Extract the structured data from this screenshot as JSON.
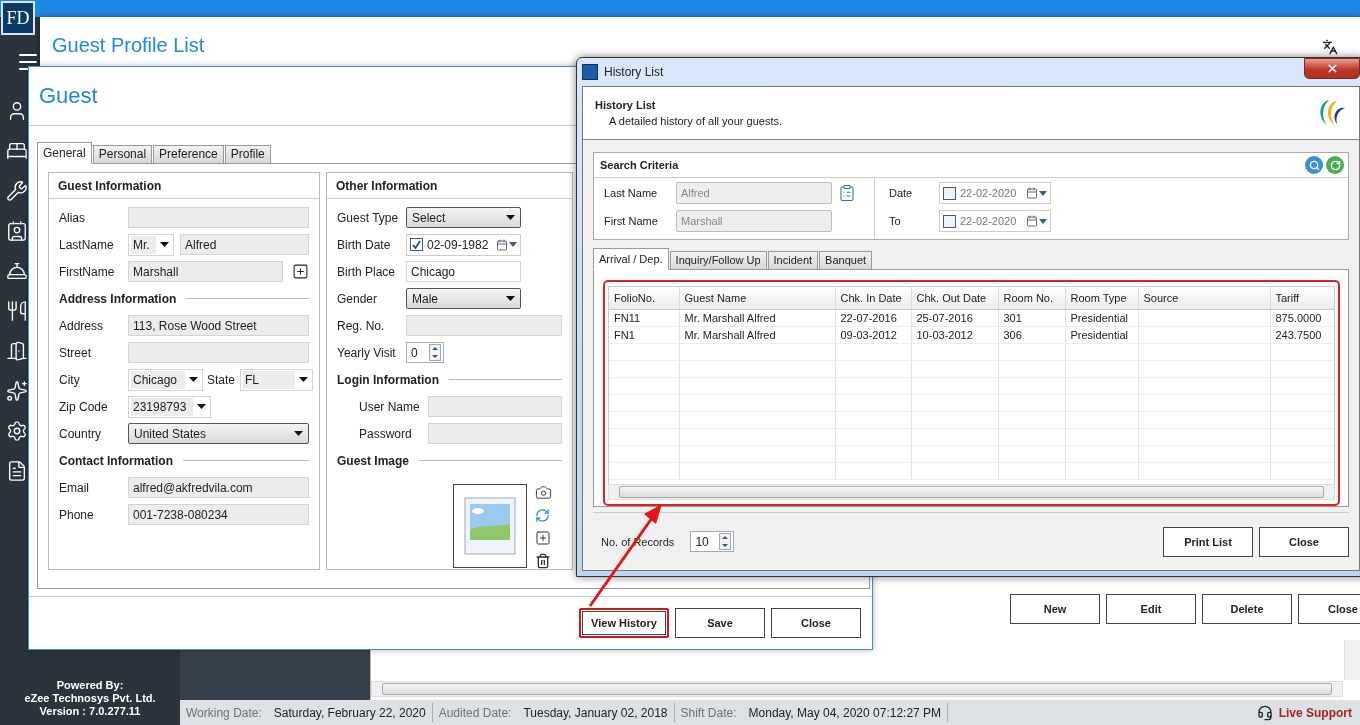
{
  "app": {
    "logo": "FD",
    "sidebar_footer": [
      "Powered By:",
      "eZee Technosys Pvt. Ltd.",
      "Version : 7.0.277.11"
    ]
  },
  "profile_list": {
    "title": "Guest Profile List",
    "buttons": [
      "New",
      "Edit",
      "Delete",
      "Close"
    ]
  },
  "guest": {
    "title": "Guest",
    "tabs": [
      {
        "label": "General",
        "selected": true
      },
      {
        "label": "Personal",
        "selected": false
      },
      {
        "label": "Preference",
        "selected": false
      },
      {
        "label": "Profile",
        "selected": false
      }
    ],
    "guest_information": {
      "title": "Guest Information",
      "rows": [
        {
          "kind": "text",
          "label": "Alias"
        },
        {
          "kind": "salutation",
          "label": "LastName",
          "salutation": "Mr.",
          "value": "Alfred"
        },
        {
          "kind": "add",
          "label": "FirstName",
          "value": "Marshall"
        },
        {
          "kind": "heading",
          "label": "Address Information"
        },
        {
          "kind": "text",
          "label": "Address",
          "value": "113, Rose Wood Street"
        },
        {
          "kind": "text",
          "label": "Street"
        },
        {
          "kind": "city",
          "label": "City",
          "value": "Chicago",
          "state_label": "State",
          "state": "FL"
        },
        {
          "kind": "combo",
          "label": "Zip Code",
          "value": "23198793"
        },
        {
          "kind": "select",
          "label": "Country",
          "value": "United States"
        },
        {
          "kind": "heading",
          "label": "Contact Information"
        },
        {
          "kind": "text",
          "label": "Email",
          "value": "alfred@akfredvila.com"
        },
        {
          "kind": "text",
          "label": "Phone",
          "value": "001-7238-080234"
        }
      ]
    },
    "other_information": {
      "title": "Other Information",
      "rows": [
        {
          "kind": "select",
          "label": "Guest Type",
          "value": "Select"
        },
        {
          "kind": "date",
          "label": "Birth Date",
          "value": "02-09-1982",
          "checked": true
        },
        {
          "kind": "white",
          "label": "Birth Place",
          "value": "Chicago"
        },
        {
          "kind": "select",
          "label": "Gender",
          "value": "Male"
        },
        {
          "kind": "text",
          "label": "Reg. No."
        },
        {
          "kind": "spin",
          "label": "Yearly Visit",
          "value": "0"
        },
        {
          "kind": "heading",
          "label": "Login Information"
        },
        {
          "kind": "login",
          "label": "User Name"
        },
        {
          "kind": "login",
          "label": "Password"
        },
        {
          "kind": "heading",
          "label": "Guest Image"
        },
        {
          "kind": "image"
        }
      ]
    },
    "buttons": [
      {
        "label": "View History",
        "highlighted": true
      },
      {
        "label": "Save",
        "highlighted": false
      },
      {
        "label": "Close",
        "highlighted": false
      }
    ]
  },
  "history": {
    "window_title": "History List",
    "title": "History List",
    "description": "A detailed history of all your guests.",
    "search": {
      "title": "Search Criteria",
      "last_name_label": "Last Name",
      "last_name": "Alfred",
      "first_name_label": "First Name",
      "first_name": "Marshall",
      "dates": [
        {
          "label": "Date",
          "value": "22-02-2020",
          "checked": false
        },
        {
          "label": "To",
          "value": "22-02-2020",
          "checked": false
        }
      ]
    },
    "tabs": [
      {
        "label": "Arrival / Dep.",
        "selected": true
      },
      {
        "label": "Inquiry/Follow Up",
        "selected": false
      },
      {
        "label": "Incident",
        "selected": false
      },
      {
        "label": "Banquet",
        "selected": false
      }
    ],
    "table": {
      "highlighted": true,
      "columns": [
        "FolioNo.",
        "Guest Name",
        "Chk. In Date",
        "Chk. Out Date",
        "Room No.",
        "Room Type",
        "Source",
        "Tariff"
      ],
      "rows": [
        [
          "FN11",
          "Mr. Marshall Alfred",
          "22-07-2016",
          "25-07-2016",
          "301",
          "Presidential",
          "",
          "875.0000"
        ],
        [
          "FN1",
          "Mr. Marshall Alfred",
          "09-03-2012",
          "10-03-2012",
          "306",
          "Presidential",
          "",
          "243.7500"
        ]
      ]
    },
    "records_label": "No. of Records",
    "records": "10",
    "buttons": [
      "Print List",
      "Close"
    ]
  },
  "annotation": {
    "arrow": true
  },
  "status_bar": [
    {
      "label": "Working Date:",
      "value": "Saturday, February 22, 2020"
    },
    {
      "label": "Audited Date:",
      "value": "Tuesday, January 02, 2018"
    },
    {
      "label": "Shift Date:",
      "value": "Monday, May 04, 2020 07:12:27 PM"
    }
  ],
  "live_support": "Live Support"
}
